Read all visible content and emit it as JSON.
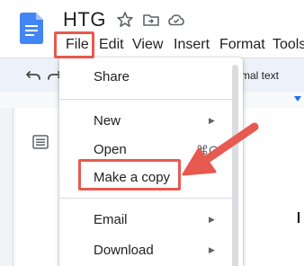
{
  "document": {
    "title": "HTG"
  },
  "menubar": {
    "items": [
      "File",
      "Edit",
      "View",
      "Insert",
      "Format",
      "Tools"
    ]
  },
  "toolbar": {
    "style_text": "rmal text"
  },
  "file_menu": {
    "share": "Share",
    "new": "New",
    "open": "Open",
    "open_shortcut": "⌘O",
    "make_copy": "Make a copy",
    "email": "Email",
    "download": "Download",
    "submenu_arrow": "▶"
  },
  "colors": {
    "highlight": "#e8594f",
    "docs_blue": "#4285f4"
  },
  "icons": [
    "docs-logo-icon",
    "star-icon",
    "move-to-folder-icon",
    "cloud-saved-icon",
    "undo-icon",
    "redo-icon",
    "document-outline-icon"
  ]
}
